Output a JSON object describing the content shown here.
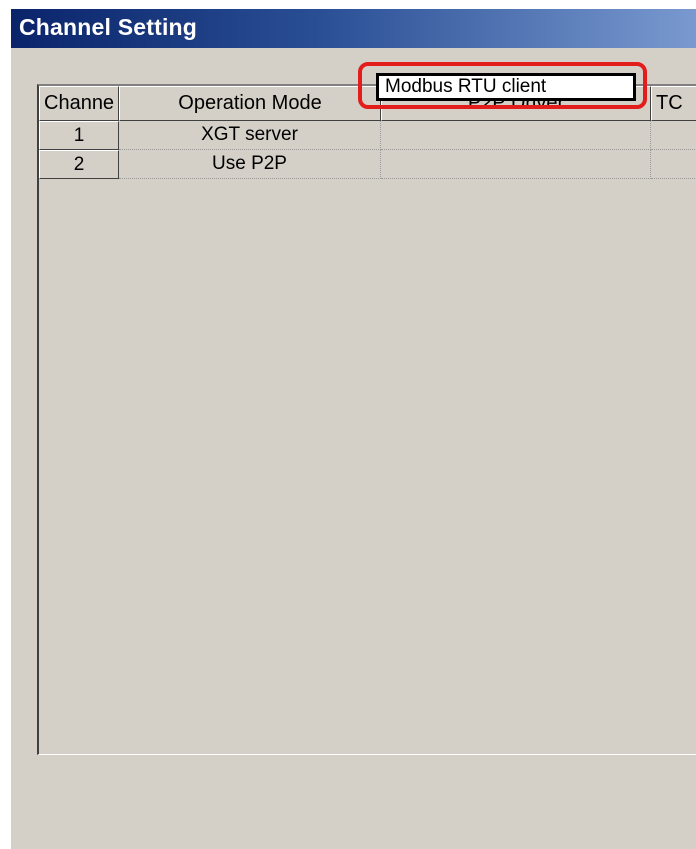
{
  "window": {
    "title": "Channel Setting"
  },
  "grid": {
    "columns": [
      "Channe",
      "Operation Mode",
      "P2P Driver",
      "TC"
    ],
    "rows": [
      {
        "channel": "1",
        "operation_mode": "XGT server",
        "p2p_driver": ""
      },
      {
        "channel": "2",
        "operation_mode": "Use P2P",
        "p2p_driver": "Modbus RTU client"
      }
    ]
  },
  "highlight": {
    "color": "#e31c1c"
  }
}
